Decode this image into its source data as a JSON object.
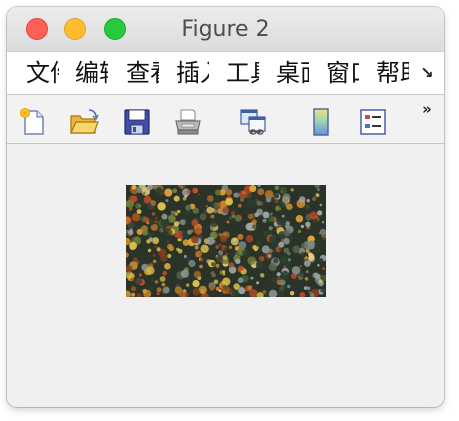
{
  "window": {
    "title": "Figure 2"
  },
  "menu": {
    "items": [
      {
        "label": "文件"
      },
      {
        "label": "编辑"
      },
      {
        "label": "查看"
      },
      {
        "label": "插入"
      },
      {
        "label": "工具"
      },
      {
        "label": "桌面"
      },
      {
        "label": "窗口"
      },
      {
        "label": "帮助"
      }
    ],
    "overflow_icon": "menu-overflow-arrow"
  },
  "toolbar": {
    "tools": [
      {
        "icon": "new-figure-icon"
      },
      {
        "icon": "open-file-icon"
      },
      {
        "icon": "save-icon"
      },
      {
        "icon": "print-icon"
      },
      {
        "icon": "link-plot-icon"
      },
      {
        "icon": "insert-colorbar-icon"
      },
      {
        "icon": "insert-legend-icon"
      }
    ],
    "overflow_icon": "toolbar-overflow-chevron"
  },
  "figure": {
    "image_content": "aerial photo of an autumn forest canopy"
  }
}
